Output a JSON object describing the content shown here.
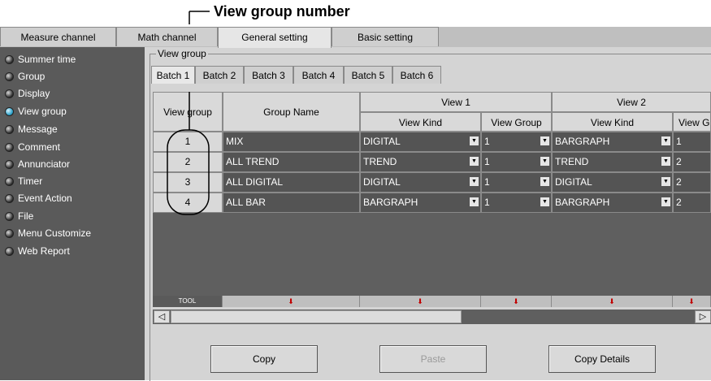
{
  "callout": {
    "title": "View group number"
  },
  "tabs": [
    {
      "label": "Measure channel"
    },
    {
      "label": "Math channel"
    },
    {
      "label": "General setting"
    },
    {
      "label": "Basic setting"
    }
  ],
  "sidebar": {
    "items": [
      {
        "label": "Summer time",
        "selected": false
      },
      {
        "label": "Group",
        "selected": false
      },
      {
        "label": "Display",
        "selected": false
      },
      {
        "label": "View group",
        "selected": true
      },
      {
        "label": "Message",
        "selected": false
      },
      {
        "label": "Comment",
        "selected": false
      },
      {
        "label": "Annunciator",
        "selected": false
      },
      {
        "label": "Timer",
        "selected": false
      },
      {
        "label": "Event Action",
        "selected": false
      },
      {
        "label": "File",
        "selected": false
      },
      {
        "label": "Menu Customize",
        "selected": false
      },
      {
        "label": "Web Report",
        "selected": false
      }
    ]
  },
  "panel": {
    "legend": "View group",
    "batch_tabs": [
      {
        "label": "Batch 1"
      },
      {
        "label": "Batch 2"
      },
      {
        "label": "Batch 3"
      },
      {
        "label": "Batch 4"
      },
      {
        "label": "Batch 5"
      },
      {
        "label": "Batch 6"
      }
    ]
  },
  "table": {
    "headers": {
      "view_group": "View group",
      "group_name": "Group Name",
      "view1": "View 1",
      "view2": "View 2",
      "view_kind": "View Kind",
      "view_group_sub": "View Group",
      "view_kind2": "View Kind",
      "view_group_sub2": "View G"
    },
    "rows": [
      {
        "num": "1",
        "name": "MIX",
        "v1kind": "DIGITAL",
        "v1group": "1",
        "v2kind": "BARGRAPH",
        "v2group": "1"
      },
      {
        "num": "2",
        "name": "ALL TREND",
        "v1kind": "TREND",
        "v1group": "1",
        "v2kind": "TREND",
        "v2group": "2"
      },
      {
        "num": "3",
        "name": "ALL DIGITAL",
        "v1kind": "DIGITAL",
        "v1group": "1",
        "v2kind": "DIGITAL",
        "v2group": "2"
      },
      {
        "num": "4",
        "name": "ALL BAR",
        "v1kind": "BARGRAPH",
        "v1group": "1",
        "v2kind": "BARGRAPH",
        "v2group": "2"
      }
    ],
    "tool_label": "TOOL"
  },
  "buttons": {
    "copy": "Copy",
    "paste": "Paste",
    "copy_details": "Copy Details"
  }
}
